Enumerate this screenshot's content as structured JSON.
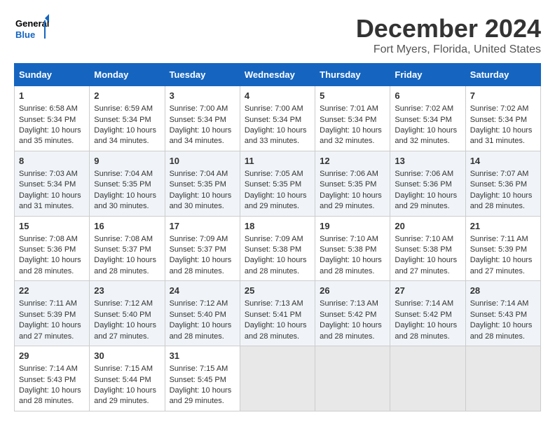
{
  "header": {
    "logo_line1": "General",
    "logo_line2": "Blue",
    "month": "December 2024",
    "location": "Fort Myers, Florida, United States"
  },
  "days_of_week": [
    "Sunday",
    "Monday",
    "Tuesday",
    "Wednesday",
    "Thursday",
    "Friday",
    "Saturday"
  ],
  "weeks": [
    [
      {
        "day": "1",
        "rise": "Sunrise: 6:58 AM",
        "set": "Sunset: 5:34 PM",
        "daylight": "Daylight: 10 hours and 35 minutes."
      },
      {
        "day": "2",
        "rise": "Sunrise: 6:59 AM",
        "set": "Sunset: 5:34 PM",
        "daylight": "Daylight: 10 hours and 34 minutes."
      },
      {
        "day": "3",
        "rise": "Sunrise: 7:00 AM",
        "set": "Sunset: 5:34 PM",
        "daylight": "Daylight: 10 hours and 34 minutes."
      },
      {
        "day": "4",
        "rise": "Sunrise: 7:00 AM",
        "set": "Sunset: 5:34 PM",
        "daylight": "Daylight: 10 hours and 33 minutes."
      },
      {
        "day": "5",
        "rise": "Sunrise: 7:01 AM",
        "set": "Sunset: 5:34 PM",
        "daylight": "Daylight: 10 hours and 32 minutes."
      },
      {
        "day": "6",
        "rise": "Sunrise: 7:02 AM",
        "set": "Sunset: 5:34 PM",
        "daylight": "Daylight: 10 hours and 32 minutes."
      },
      {
        "day": "7",
        "rise": "Sunrise: 7:02 AM",
        "set": "Sunset: 5:34 PM",
        "daylight": "Daylight: 10 hours and 31 minutes."
      }
    ],
    [
      {
        "day": "8",
        "rise": "Sunrise: 7:03 AM",
        "set": "Sunset: 5:34 PM",
        "daylight": "Daylight: 10 hours and 31 minutes."
      },
      {
        "day": "9",
        "rise": "Sunrise: 7:04 AM",
        "set": "Sunset: 5:35 PM",
        "daylight": "Daylight: 10 hours and 30 minutes."
      },
      {
        "day": "10",
        "rise": "Sunrise: 7:04 AM",
        "set": "Sunset: 5:35 PM",
        "daylight": "Daylight: 10 hours and 30 minutes."
      },
      {
        "day": "11",
        "rise": "Sunrise: 7:05 AM",
        "set": "Sunset: 5:35 PM",
        "daylight": "Daylight: 10 hours and 29 minutes."
      },
      {
        "day": "12",
        "rise": "Sunrise: 7:06 AM",
        "set": "Sunset: 5:35 PM",
        "daylight": "Daylight: 10 hours and 29 minutes."
      },
      {
        "day": "13",
        "rise": "Sunrise: 7:06 AM",
        "set": "Sunset: 5:36 PM",
        "daylight": "Daylight: 10 hours and 29 minutes."
      },
      {
        "day": "14",
        "rise": "Sunrise: 7:07 AM",
        "set": "Sunset: 5:36 PM",
        "daylight": "Daylight: 10 hours and 28 minutes."
      }
    ],
    [
      {
        "day": "15",
        "rise": "Sunrise: 7:08 AM",
        "set": "Sunset: 5:36 PM",
        "daylight": "Daylight: 10 hours and 28 minutes."
      },
      {
        "day": "16",
        "rise": "Sunrise: 7:08 AM",
        "set": "Sunset: 5:37 PM",
        "daylight": "Daylight: 10 hours and 28 minutes."
      },
      {
        "day": "17",
        "rise": "Sunrise: 7:09 AM",
        "set": "Sunset: 5:37 PM",
        "daylight": "Daylight: 10 hours and 28 minutes."
      },
      {
        "day": "18",
        "rise": "Sunrise: 7:09 AM",
        "set": "Sunset: 5:38 PM",
        "daylight": "Daylight: 10 hours and 28 minutes."
      },
      {
        "day": "19",
        "rise": "Sunrise: 7:10 AM",
        "set": "Sunset: 5:38 PM",
        "daylight": "Daylight: 10 hours and 28 minutes."
      },
      {
        "day": "20",
        "rise": "Sunrise: 7:10 AM",
        "set": "Sunset: 5:38 PM",
        "daylight": "Daylight: 10 hours and 27 minutes."
      },
      {
        "day": "21",
        "rise": "Sunrise: 7:11 AM",
        "set": "Sunset: 5:39 PM",
        "daylight": "Daylight: 10 hours and 27 minutes."
      }
    ],
    [
      {
        "day": "22",
        "rise": "Sunrise: 7:11 AM",
        "set": "Sunset: 5:39 PM",
        "daylight": "Daylight: 10 hours and 27 minutes."
      },
      {
        "day": "23",
        "rise": "Sunrise: 7:12 AM",
        "set": "Sunset: 5:40 PM",
        "daylight": "Daylight: 10 hours and 27 minutes."
      },
      {
        "day": "24",
        "rise": "Sunrise: 7:12 AM",
        "set": "Sunset: 5:40 PM",
        "daylight": "Daylight: 10 hours and 28 minutes."
      },
      {
        "day": "25",
        "rise": "Sunrise: 7:13 AM",
        "set": "Sunset: 5:41 PM",
        "daylight": "Daylight: 10 hours and 28 minutes."
      },
      {
        "day": "26",
        "rise": "Sunrise: 7:13 AM",
        "set": "Sunset: 5:42 PM",
        "daylight": "Daylight: 10 hours and 28 minutes."
      },
      {
        "day": "27",
        "rise": "Sunrise: 7:14 AM",
        "set": "Sunset: 5:42 PM",
        "daylight": "Daylight: 10 hours and 28 minutes."
      },
      {
        "day": "28",
        "rise": "Sunrise: 7:14 AM",
        "set": "Sunset: 5:43 PM",
        "daylight": "Daylight: 10 hours and 28 minutes."
      }
    ],
    [
      {
        "day": "29",
        "rise": "Sunrise: 7:14 AM",
        "set": "Sunset: 5:43 PM",
        "daylight": "Daylight: 10 hours and 28 minutes."
      },
      {
        "day": "30",
        "rise": "Sunrise: 7:15 AM",
        "set": "Sunset: 5:44 PM",
        "daylight": "Daylight: 10 hours and 29 minutes."
      },
      {
        "day": "31",
        "rise": "Sunrise: 7:15 AM",
        "set": "Sunset: 5:45 PM",
        "daylight": "Daylight: 10 hours and 29 minutes."
      },
      {
        "day": "",
        "rise": "",
        "set": "",
        "daylight": ""
      },
      {
        "day": "",
        "rise": "",
        "set": "",
        "daylight": ""
      },
      {
        "day": "",
        "rise": "",
        "set": "",
        "daylight": ""
      },
      {
        "day": "",
        "rise": "",
        "set": "",
        "daylight": ""
      }
    ]
  ]
}
